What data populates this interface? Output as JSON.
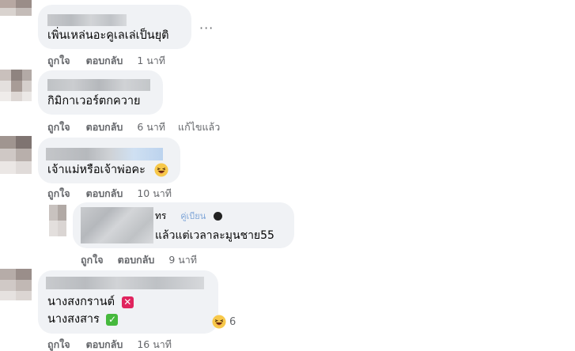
{
  "comments": [
    {
      "text": "เพิ่นเหล่นอะคูเลเล่เป็นยุติ",
      "like_label": "ถูกใจ",
      "reply_label": "ตอบกลับ",
      "time": "1 นาที",
      "more_label": "···"
    },
    {
      "text": "กิมิกาเวอร์ตกควาย",
      "like_label": "ถูกใจ",
      "reply_label": "ตอบกลับ",
      "time": "6 นาที",
      "edited_label": "แก้ไขแล้ว"
    },
    {
      "text": "เจ้าแม่หรือเจ้าพ่อคะ",
      "like_label": "ถูกใจ",
      "reply_label": "ตอบกลับ",
      "time": "10 นาที",
      "emoji": "laughing-face"
    },
    {
      "text": "แล้วแต่เวลาละมูนชาย55",
      "partial_header": "ทร",
      "partial_badge": "คู่เบียน",
      "like_label": "ถูกใจ",
      "reply_label": "ตอบกลับ",
      "time": "9 นาที"
    },
    {
      "line1": "นางสงกรานต์",
      "line1_badge": "cross-mark",
      "line2": "นางสงสาร",
      "line2_badge": "check-mark",
      "reaction_count": "6",
      "reaction_emoji": "laughing-face",
      "like_label": "ถูกใจ",
      "reply_label": "ตอบกลับ",
      "time": "16 นาที"
    }
  ]
}
